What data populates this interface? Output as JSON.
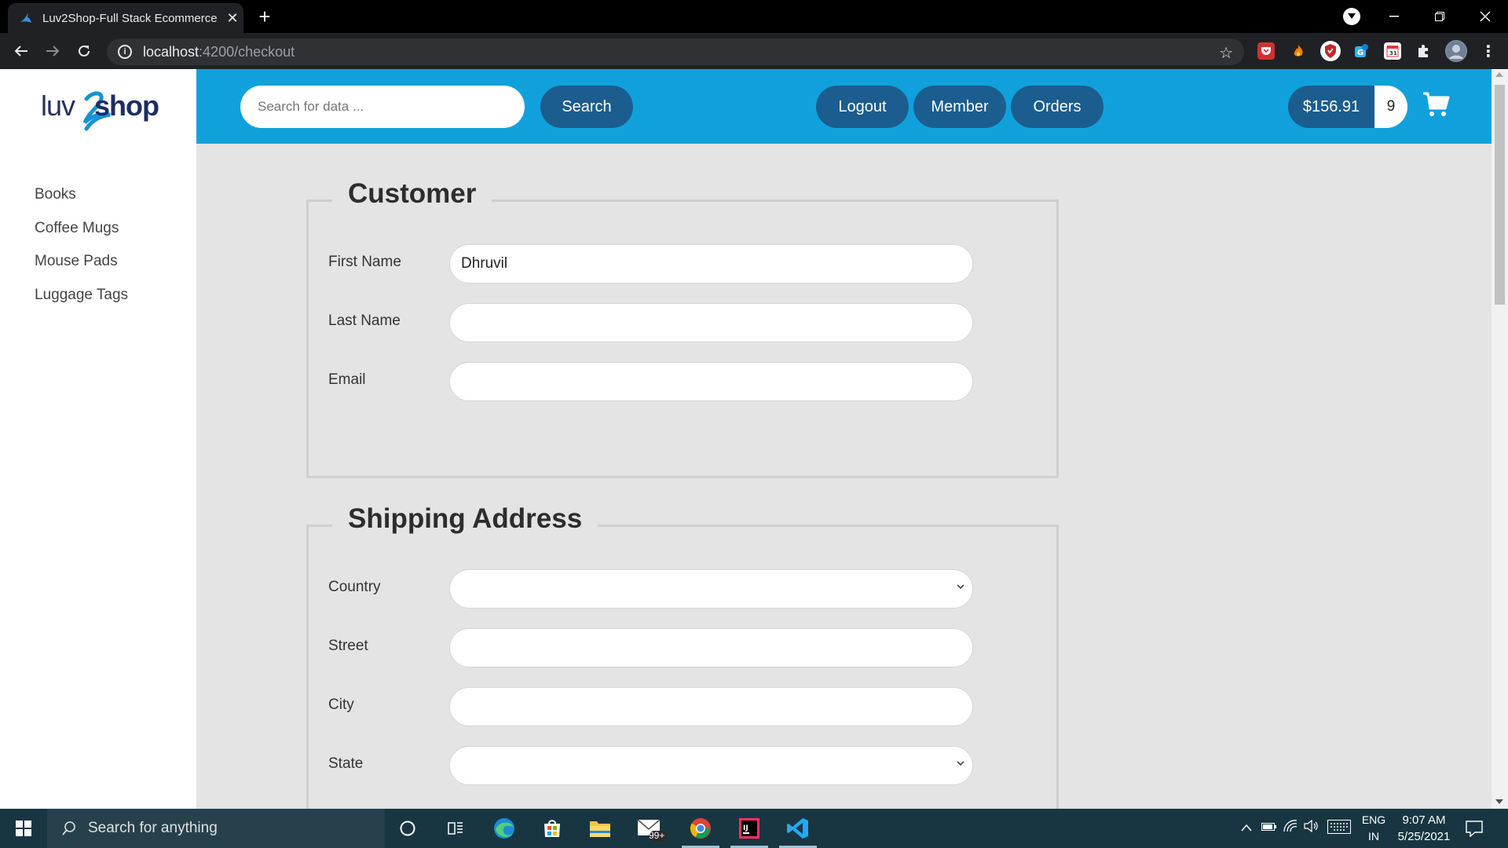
{
  "browser": {
    "tab_title": "Luv2Shop-Full Stack Ecommerce",
    "tab_close": "✕",
    "new_tab": "+",
    "url_host": "localhost",
    "url_path": ":4200/checkout"
  },
  "site": {
    "logo_left": "luv",
    "logo_right": "shop",
    "categories": [
      "Books",
      "Coffee Mugs",
      "Mouse Pads",
      "Luggage Tags"
    ]
  },
  "header": {
    "search_placeholder": "Search for data ...",
    "search_button": "Search",
    "logout_button": "Logout",
    "member_button": "Member",
    "orders_button": "Orders",
    "cart_total": "$156.91",
    "cart_count": "9"
  },
  "customer": {
    "legend": "Customer",
    "first_name_label": "First Name",
    "first_name_value": "Dhruvil",
    "last_name_label": "Last Name",
    "last_name_value": "",
    "email_label": "Email",
    "email_value": ""
  },
  "shipping": {
    "legend": "Shipping Address",
    "country_label": "Country",
    "country_value": "",
    "street_label": "Street",
    "street_value": "",
    "city_label": "City",
    "city_value": "",
    "state_label": "State",
    "state_value": ""
  },
  "taskbar": {
    "search_text": "Search for anything",
    "mail_badge": "99+",
    "lang_top": "ENG",
    "lang_bottom": "IN",
    "time": "9:07 AM",
    "date": "5/25/2021"
  },
  "colors": {
    "header_blue": "#10a1dc",
    "button_blue": "#1b5d8e",
    "taskbar": "#183642"
  }
}
